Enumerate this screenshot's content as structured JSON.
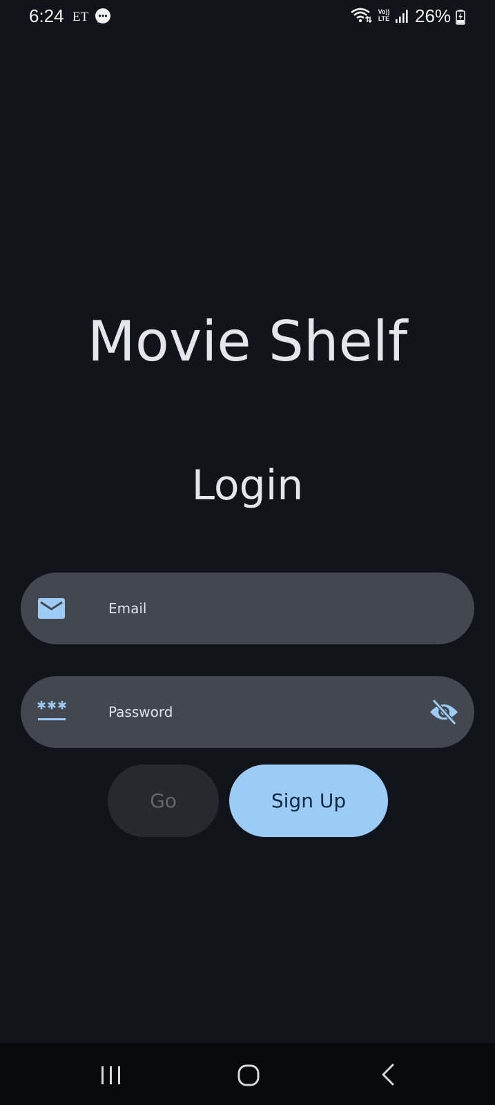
{
  "status_bar": {
    "time": "6:24",
    "carrier_badge": "ET",
    "volte_line1": "Vo))",
    "volte_line2": "LTE",
    "battery_percent": "26%",
    "icons": [
      "message-icon",
      "wifi-icon",
      "volte-icon",
      "signal-icon",
      "battery-charging-icon"
    ]
  },
  "app": {
    "title": "Movie Shelf",
    "screen_title": "Login"
  },
  "form": {
    "email": {
      "placeholder": "Email",
      "value": "",
      "icon": "mail-icon"
    },
    "password": {
      "placeholder": "Password",
      "value": "",
      "icon": "password-icon",
      "toggle_icon": "visibility-off-icon"
    }
  },
  "buttons": {
    "go": "Go",
    "signup": "Sign Up"
  },
  "nav_bar": {
    "icons": [
      "recents-icon",
      "home-icon",
      "back-icon"
    ]
  },
  "colors": {
    "background": "#11141a",
    "field_background": "#434850",
    "accent": "#9ccbf5",
    "disabled_button": "#26292f"
  }
}
